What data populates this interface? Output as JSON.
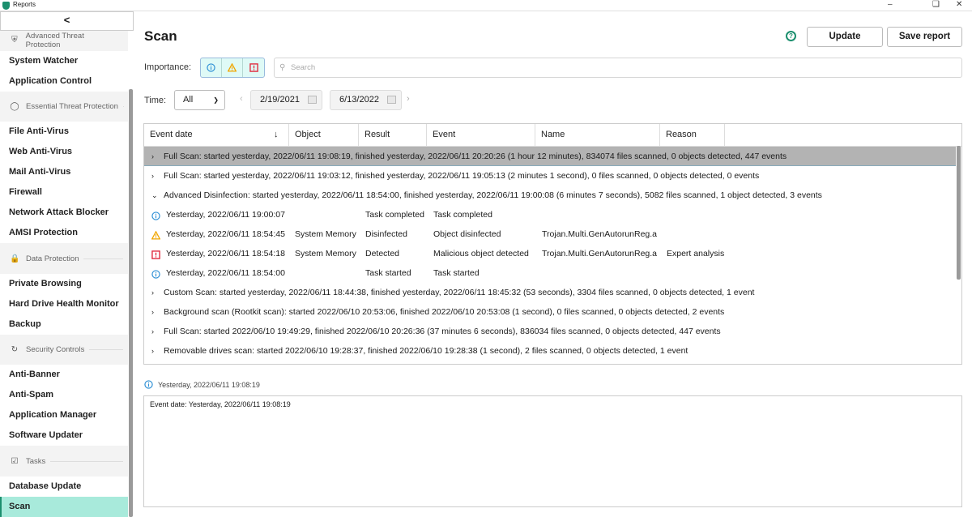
{
  "window": {
    "title": "Reports",
    "controls": [
      "minimize",
      "restore",
      "close"
    ]
  },
  "sidebar": {
    "back_label": "<",
    "sections": [
      {
        "title": "Advanced Threat Protection",
        "icon": "shield-icon",
        "items": [
          "System Watcher",
          "Application Control"
        ]
      },
      {
        "title": "Essential Threat Protection",
        "icon": "shield-outline-icon",
        "items": [
          "File Anti-Virus",
          "Web Anti-Virus",
          "Mail Anti-Virus",
          "Firewall",
          "Network Attack Blocker",
          "AMSI Protection"
        ]
      },
      {
        "title": "Data Protection",
        "icon": "lock-icon",
        "items": [
          "Private Browsing",
          "Hard Drive Health Monitor",
          "Backup"
        ]
      },
      {
        "title": "Security Controls",
        "icon": "refresh-icon",
        "items": [
          "Anti-Banner",
          "Anti-Spam",
          "Application Manager",
          "Software Updater"
        ]
      },
      {
        "title": "Tasks",
        "icon": "clipboard-check-icon",
        "items": [
          "Database Update",
          "Scan"
        ]
      }
    ],
    "active_item": "Scan"
  },
  "main": {
    "title": "Scan",
    "update_label": "Update",
    "save_label": "Save report",
    "importance_label": "Importance:",
    "search_placeholder": "Search",
    "time_label": "Time:",
    "time_value": "All",
    "date_from": "2/19/2021",
    "date_to": "6/13/2022",
    "columns": [
      "Event date",
      "Object",
      "Result",
      "Event",
      "Name",
      "Reason"
    ],
    "rows": [
      {
        "type": "group",
        "expanded": false,
        "selected": true,
        "text": "Full Scan: started yesterday, 2022/06/11 19:08:19, finished yesterday, 2022/06/11 20:20:26 (1 hour 12 minutes), 834074 files scanned, 0 objects detected, 447 events"
      },
      {
        "type": "group",
        "expanded": false,
        "text": "Full Scan: started yesterday, 2022/06/11 19:03:12, finished yesterday, 2022/06/11 19:05:13 (2 minutes 1 second), 0 files scanned, 0 objects detected, 0 events"
      },
      {
        "type": "group",
        "expanded": true,
        "text": "Advanced Disinfection: started yesterday, 2022/06/11 18:54:00, finished yesterday, 2022/06/11 19:00:08 (6 minutes 7 seconds), 5082 files scanned, 1 object detected, 3 events"
      },
      {
        "type": "event",
        "severity": "info",
        "date": "Yesterday, 2022/06/11 19:00:07",
        "object": "",
        "result": "Task completed",
        "event": "Task completed",
        "name": "",
        "reason": ""
      },
      {
        "type": "event",
        "severity": "warning",
        "date": "Yesterday, 2022/06/11 18:54:45",
        "object": "System Memory",
        "result": "Disinfected",
        "event": "Object disinfected",
        "name": "Trojan.Multi.GenAutorunReg.a",
        "reason": ""
      },
      {
        "type": "event",
        "severity": "critical",
        "date": "Yesterday, 2022/06/11 18:54:18",
        "object": "System Memory",
        "result": "Detected",
        "event": "Malicious object detected",
        "name": "Trojan.Multi.GenAutorunReg.a",
        "reason": "Expert analysis"
      },
      {
        "type": "event",
        "severity": "info",
        "date": "Yesterday, 2022/06/11 18:54:00",
        "object": "",
        "result": "Task started",
        "event": "Task started",
        "name": "",
        "reason": ""
      },
      {
        "type": "group",
        "expanded": false,
        "text": "Custom Scan: started yesterday, 2022/06/11 18:44:38, finished yesterday, 2022/06/11 18:45:32 (53 seconds), 3304 files scanned, 0 objects detected, 1 event"
      },
      {
        "type": "group",
        "expanded": false,
        "text": "Background scan (Rootkit scan): started 2022/06/10 20:53:06, finished 2022/06/10 20:53:08 (1 second), 0 files scanned, 0 objects detected, 2 events"
      },
      {
        "type": "group",
        "expanded": false,
        "text": "Full Scan: started 2022/06/10 19:49:29, finished 2022/06/10 20:26:36 (37 minutes 6 seconds), 836034 files scanned, 0 objects detected, 447 events"
      },
      {
        "type": "group",
        "expanded": false,
        "text": "Removable drives scan: started 2022/06/10 19:28:37, finished 2022/06/10 19:28:38 (1 second), 2 files scanned, 0 objects detected, 1 event"
      }
    ],
    "details": {
      "header": "Yesterday, 2022/06/11 19:08:19",
      "body": "Event date: Yesterday, 2022/06/11 19:08:19"
    }
  },
  "colors": {
    "accent": "#1c8f6e",
    "active_bg": "#a8eadb",
    "info": "#2d8fd5",
    "warning": "#f0a500",
    "critical": "#e0283c",
    "selected_row": "#b3b3b3"
  }
}
